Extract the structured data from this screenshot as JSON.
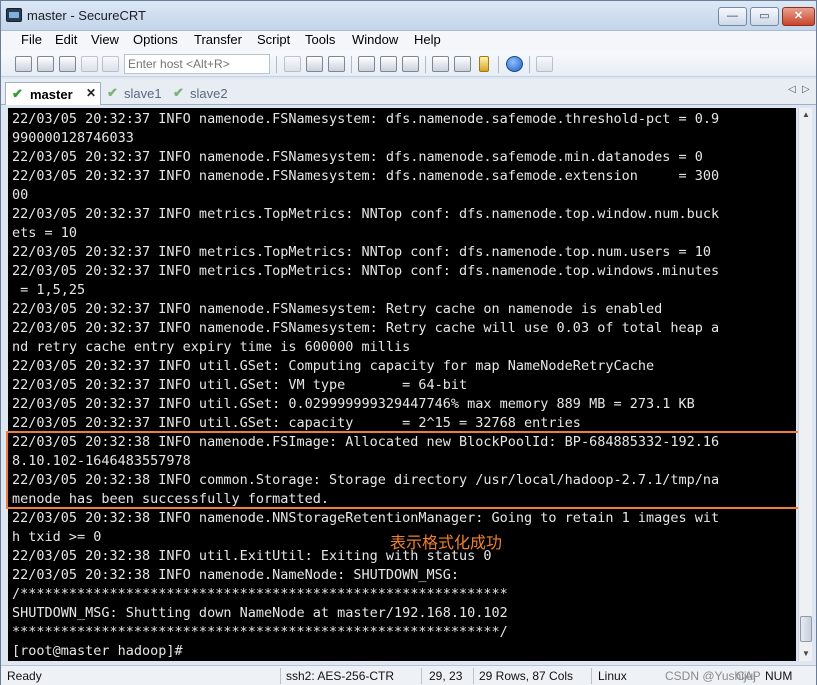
{
  "window": {
    "title": "master - SecureCRT",
    "controls": {
      "minimize": "—",
      "maximize": "▭",
      "close": "✕"
    }
  },
  "menu": [
    "File",
    "Edit",
    "View",
    "Options",
    "Transfer",
    "Script",
    "Tools",
    "Window",
    "Help"
  ],
  "toolbar": {
    "host_placeholder": "Enter host <Alt+R>",
    "icons": [
      "connect-icon",
      "quick-connect-icon",
      "connect-tab-icon",
      "reconnect-icon",
      "disconnect-icon",
      "copy-icon",
      "paste-icon",
      "find-icon",
      "print-icon",
      "print-setup-icon",
      "printer-icon",
      "session-options-icon",
      "global-options-icon",
      "keymap-icon",
      "help-icon",
      "screen-icon"
    ]
  },
  "tabs": [
    {
      "label": "master",
      "active": true,
      "close": "✕"
    },
    {
      "label": "slave1",
      "active": false
    },
    {
      "label": "slave2",
      "active": false
    }
  ],
  "tab_nav": {
    "prev": "◁",
    "next": "▷"
  },
  "terminal": {
    "lines": [
      "22/03/05 20:32:37 INFO namenode.FSNamesystem: dfs.namenode.safemode.threshold-pct = 0.9",
      "990000128746033",
      "22/03/05 20:32:37 INFO namenode.FSNamesystem: dfs.namenode.safemode.min.datanodes = 0",
      "22/03/05 20:32:37 INFO namenode.FSNamesystem: dfs.namenode.safemode.extension     = 300",
      "00",
      "22/03/05 20:32:37 INFO metrics.TopMetrics: NNTop conf: dfs.namenode.top.window.num.buck",
      "ets = 10",
      "22/03/05 20:32:37 INFO metrics.TopMetrics: NNTop conf: dfs.namenode.top.num.users = 10",
      "22/03/05 20:32:37 INFO metrics.TopMetrics: NNTop conf: dfs.namenode.top.windows.minutes",
      " = 1,5,25",
      "22/03/05 20:32:37 INFO namenode.FSNamesystem: Retry cache on namenode is enabled",
      "22/03/05 20:32:37 INFO namenode.FSNamesystem: Retry cache will use 0.03 of total heap a",
      "nd retry cache entry expiry time is 600000 millis",
      "22/03/05 20:32:37 INFO util.GSet: Computing capacity for map NameNodeRetryCache",
      "22/03/05 20:32:37 INFO util.GSet: VM type       = 64-bit",
      "22/03/05 20:32:37 INFO util.GSet: 0.029999999329447746% max memory 889 MB = 273.1 KB",
      "22/03/05 20:32:37 INFO util.GSet: capacity      = 2^15 = 32768 entries",
      "22/03/05 20:32:38 INFO namenode.FSImage: Allocated new BlockPoolId: BP-684885332-192.16",
      "8.10.102-1646483557978",
      "22/03/05 20:32:38 INFO common.Storage: Storage directory /usr/local/hadoop-2.7.1/tmp/na",
      "menode has been successfully formatted.",
      "22/03/05 20:32:38 INFO namenode.NNStorageRetentionManager: Going to retain 1 images wit",
      "h txid >= 0",
      "22/03/05 20:32:38 INFO util.ExitUtil: Exiting with status 0",
      "22/03/05 20:32:38 INFO namenode.NameNode: SHUTDOWN_MSG:",
      "/************************************************************",
      "SHUTDOWN_MSG: Shutting down NameNode at master/192.168.10.102",
      "************************************************************/",
      "[root@master hadoop]#"
    ],
    "annotation": "表示格式化成功",
    "annotation_color": "#f0822c",
    "highlight_color": "#ef7d35",
    "text_color": "#e6e6e6",
    "background": "#000000"
  },
  "scrollbar": {
    "up": "▲",
    "down": "▼"
  },
  "statusbar": {
    "ready": "Ready",
    "protocol": "ssh2: AES-256-CTR",
    "cursor": "29,  23",
    "size": "29 Rows, 87 Cols",
    "os": "Linux",
    "caps": "CAP",
    "num": "NUM",
    "watermark": "CSDN @Yushijuj"
  }
}
